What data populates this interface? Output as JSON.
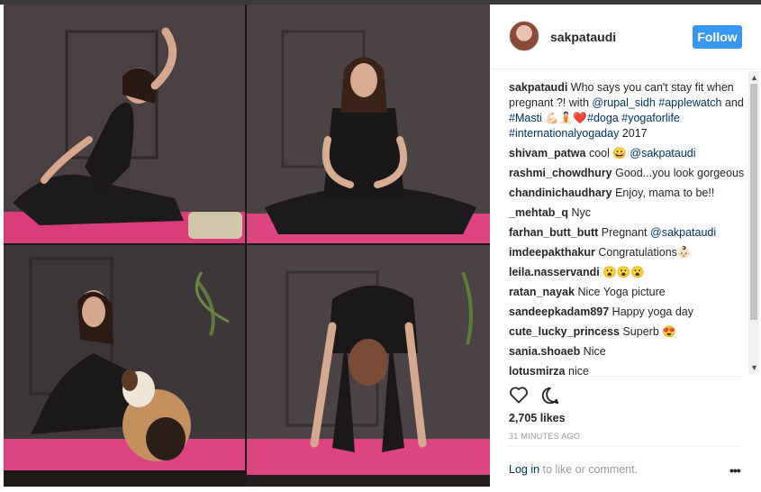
{
  "post": {
    "username": "sakpataudi",
    "follow_label": "Follow",
    "caption": {
      "user": "sakpataudi",
      "text_a": " Who says you can't stay fit when pregnant ?! with ",
      "mention": "@rupal_sidh",
      "hashtag_a": "#applewatch",
      "and": " and ",
      "hashtag_b": "#Masti",
      "emoji": " 💪🏻🧘🏻❤️",
      "hashtag_c": "#doga",
      "hashtag_d": "#yogaforlife",
      "hashtag_e": "#internationalyogaday",
      "year": " 2017"
    },
    "comments": [
      {
        "user": "shivam_patwa",
        "text": " cool 😀 ",
        "mention": "@sakpataudi"
      },
      {
        "user": "rashmi_chowdhury",
        "text": " Good...you look gorgeous",
        "mention": ""
      },
      {
        "user": "chandinichaudhary",
        "text": " Enjoy, mama to be!!",
        "mention": ""
      },
      {
        "user": "_mehtab_q",
        "text": " Nyc",
        "mention": ""
      },
      {
        "user": "farhan_butt_butt",
        "text": " Pregnant ",
        "mention": "@sakpataudi"
      },
      {
        "user": "imdeepakthakur",
        "text": " Congratulations👶🏻",
        "mention": ""
      },
      {
        "user": "leila.nasservandi",
        "text": " 😮😮😮",
        "mention": ""
      },
      {
        "user": "ratan_nayak",
        "text": " Nice Yoga picture",
        "mention": ""
      },
      {
        "user": "sandeepkadam897",
        "text": " Happy yoga day",
        "mention": ""
      },
      {
        "user": "cute_lucky_princess",
        "text": " Superb 😍",
        "mention": ""
      },
      {
        "user": "sania.shoaeb",
        "text": " Nice",
        "mention": ""
      },
      {
        "user": "lotusmirza",
        "text": " nice",
        "mention": ""
      }
    ],
    "likes": "2,705 likes",
    "time": "31 MINUTES AGO",
    "login_link": "Log in",
    "login_rest": " to like or comment.",
    "more": "•••"
  },
  "icons": {
    "heart": "heart-outline-icon",
    "comment": "comment-bubble-icon",
    "scroll_up": "▲",
    "scroll_down": "▼"
  },
  "colors": {
    "follow": "#3897f0",
    "link": "#003569",
    "mat": "#e0407e"
  }
}
